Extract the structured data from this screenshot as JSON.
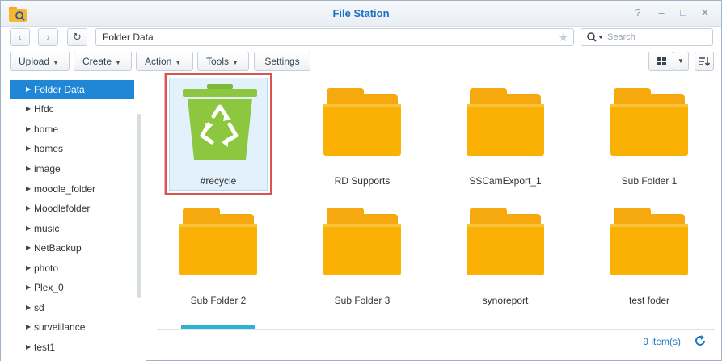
{
  "window": {
    "title": "File Station",
    "controls": [
      "?",
      "–",
      "□",
      "✕"
    ]
  },
  "nav": {
    "back": "‹",
    "forward": "›",
    "refresh": "↻",
    "path": "Folder Data",
    "search_placeholder": "Search"
  },
  "toolbar": {
    "upload": "Upload",
    "create": "Create",
    "action": "Action",
    "tools": "Tools",
    "settings": "Settings"
  },
  "sidebar": {
    "items": [
      {
        "label": "Folder Data",
        "active": true
      },
      {
        "label": "Hfdc"
      },
      {
        "label": "home"
      },
      {
        "label": "homes"
      },
      {
        "label": "image"
      },
      {
        "label": "moodle_folder"
      },
      {
        "label": "Moodlefolder"
      },
      {
        "label": "music"
      },
      {
        "label": "NetBackup"
      },
      {
        "label": "photo"
      },
      {
        "label": "Plex_0"
      },
      {
        "label": "sd"
      },
      {
        "label": "surveillance"
      },
      {
        "label": "test1"
      }
    ]
  },
  "files": [
    {
      "name": "#recycle",
      "type": "recycle-bin",
      "selected": true
    },
    {
      "name": "RD Supports",
      "type": "folder"
    },
    {
      "name": "SSCamExport_1",
      "type": "folder"
    },
    {
      "name": "Sub Folder 1",
      "type": "folder"
    },
    {
      "name": "Sub Folder 2",
      "type": "folder"
    },
    {
      "name": "Sub Folder 3",
      "type": "folder"
    },
    {
      "name": "synoreport",
      "type": "folder"
    },
    {
      "name": "test foder",
      "type": "folder"
    }
  ],
  "status": {
    "count": "9 item(s)"
  },
  "colors": {
    "accent": "#1f87d6",
    "folder": "#fbb004",
    "recycle": "#8dc63f",
    "highlight": "#d9534f"
  }
}
